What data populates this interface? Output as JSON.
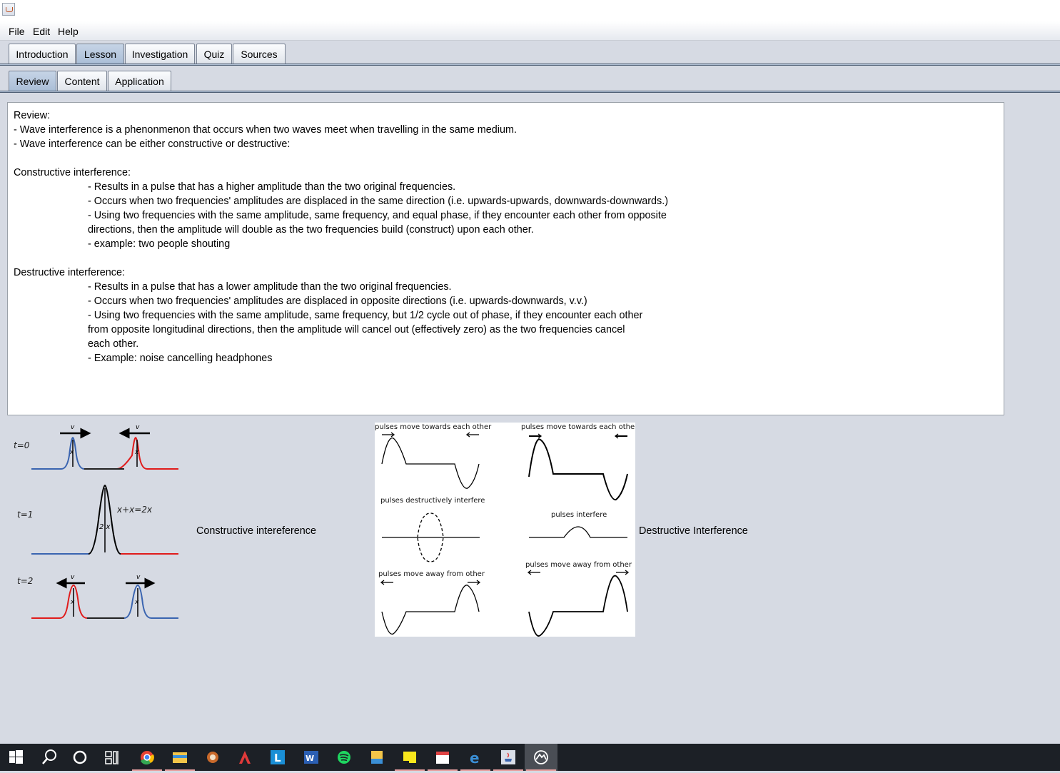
{
  "menu": [
    "File",
    "Edit",
    "Help"
  ],
  "tabs": [
    "Introduction",
    "Lesson",
    "Investigation",
    "Quiz",
    "Sources"
  ],
  "subtabs": [
    "Review",
    "Content",
    "Application"
  ],
  "review": {
    "heading": "Review:",
    "intro1": "- Wave interference is a phenonmenon that occurs when two waves meet when travelling in the same medium.",
    "intro2": "- Wave interference can be either constructive or destructive:",
    "constructive_heading": "Constructive interference:",
    "c1": "- Results in a pulse that has a higher amplitude than the two original frequencies.",
    "c2": "- Occurs when two frequencies' amplitudes are displaced in the same direction (i.e. upwards-upwards, downwards-downwards.)",
    "c3": "- Using two frequencies with the same amplitude, same frequency, and equal phase, if they encounter each other from opposite",
    "c4": "directions, then the amplitude will double as the two frequencies build (construct) upon each other.",
    "c5": "- example: two people shouting",
    "destructive_heading": "Destructive interference:",
    "d1": "- Results in a pulse that has a lower amplitude than the two original frequencies.",
    "d2": "- Occurs when two frequencies' amplitudes are displaced in opposite directions (i.e. upwards-downwards, v.v.)",
    "d3": "- Using two frequencies with the same amplitude, same frequency, but 1/2 cycle out of phase, if they encounter each other",
    "d4": "from opposite longitudinal directions, then the amplitude will cancel out (effectively zero) as the two frequencies cancel",
    "d5": "each other.",
    "d6": "- Example: noise cancelling headphones"
  },
  "constructive_diagram": {
    "t0": "t=0",
    "t1": "t=1",
    "t2": "t=2",
    "v": "v",
    "x": "x",
    "sum": "x+x=2x",
    "two_x": "2 x"
  },
  "destructive_diagram": {
    "towards": "pulses move towards each other",
    "destructively": "pulses destructively interfere",
    "interfere": "pulses interfere",
    "away": "pulses move away from other"
  },
  "captions": {
    "constructive": "Constructive intereference",
    "destructive": "Destructive Interference"
  },
  "colors": {
    "blue": "#3a64b0",
    "red": "#e01b1b",
    "taskbar": "#1c2026"
  },
  "taskbar_icons": [
    "windows-start-icon",
    "search-icon",
    "cortana-icon",
    "task-view-icon",
    "chrome-icon",
    "file-explorer-icon",
    "brave-icon",
    "app-icon",
    "l-app-icon",
    "word-icon",
    "spotify-icon",
    "photos-icon",
    "sticky-notes-icon",
    "calendar-icon",
    "edge-icon",
    "java-icon",
    "app-active-icon"
  ]
}
